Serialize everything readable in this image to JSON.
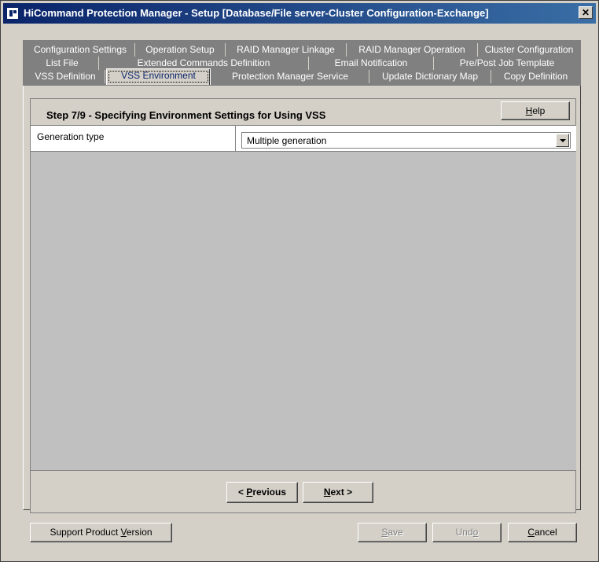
{
  "window": {
    "title": "HiCommand Protection Manager - Setup [Database/File server-Cluster Configuration-Exchange]",
    "close_label": "✕"
  },
  "tabs": {
    "row1": [
      "Configuration Settings",
      "Operation Setup",
      "RAID Manager Linkage",
      "RAID Manager Operation",
      "Cluster Configuration"
    ],
    "row2": [
      "List File",
      "Extended Commands Definition",
      "Email Notification",
      "Pre/Post Job Template"
    ],
    "row3": [
      "VSS Definition",
      "VSS Environment",
      "Protection Manager Service",
      "Update Dictionary Map",
      "Copy Definition"
    ],
    "active": "VSS Environment"
  },
  "step": {
    "title": "Step 7/9 - Specifying Environment Settings for Using VSS",
    "help": {
      "pre": "",
      "key": "H",
      "post": "elp"
    }
  },
  "settings": {
    "generation_type_label": "Generation type",
    "generation_type_value": "Multiple generation"
  },
  "nav": {
    "previous": {
      "pre": "< ",
      "key": "P",
      "post": "revious"
    },
    "next": {
      "pre": "",
      "key": "N",
      "post": "ext >"
    }
  },
  "footer": {
    "support": {
      "pre": "Support Product ",
      "key": "V",
      "post": "ersion"
    },
    "save": {
      "pre": "",
      "key": "S",
      "post": "ave"
    },
    "undo": {
      "pre": "Und",
      "key": "o",
      "post": ""
    },
    "cancel": {
      "pre": "",
      "key": "C",
      "post": "ancel"
    }
  }
}
